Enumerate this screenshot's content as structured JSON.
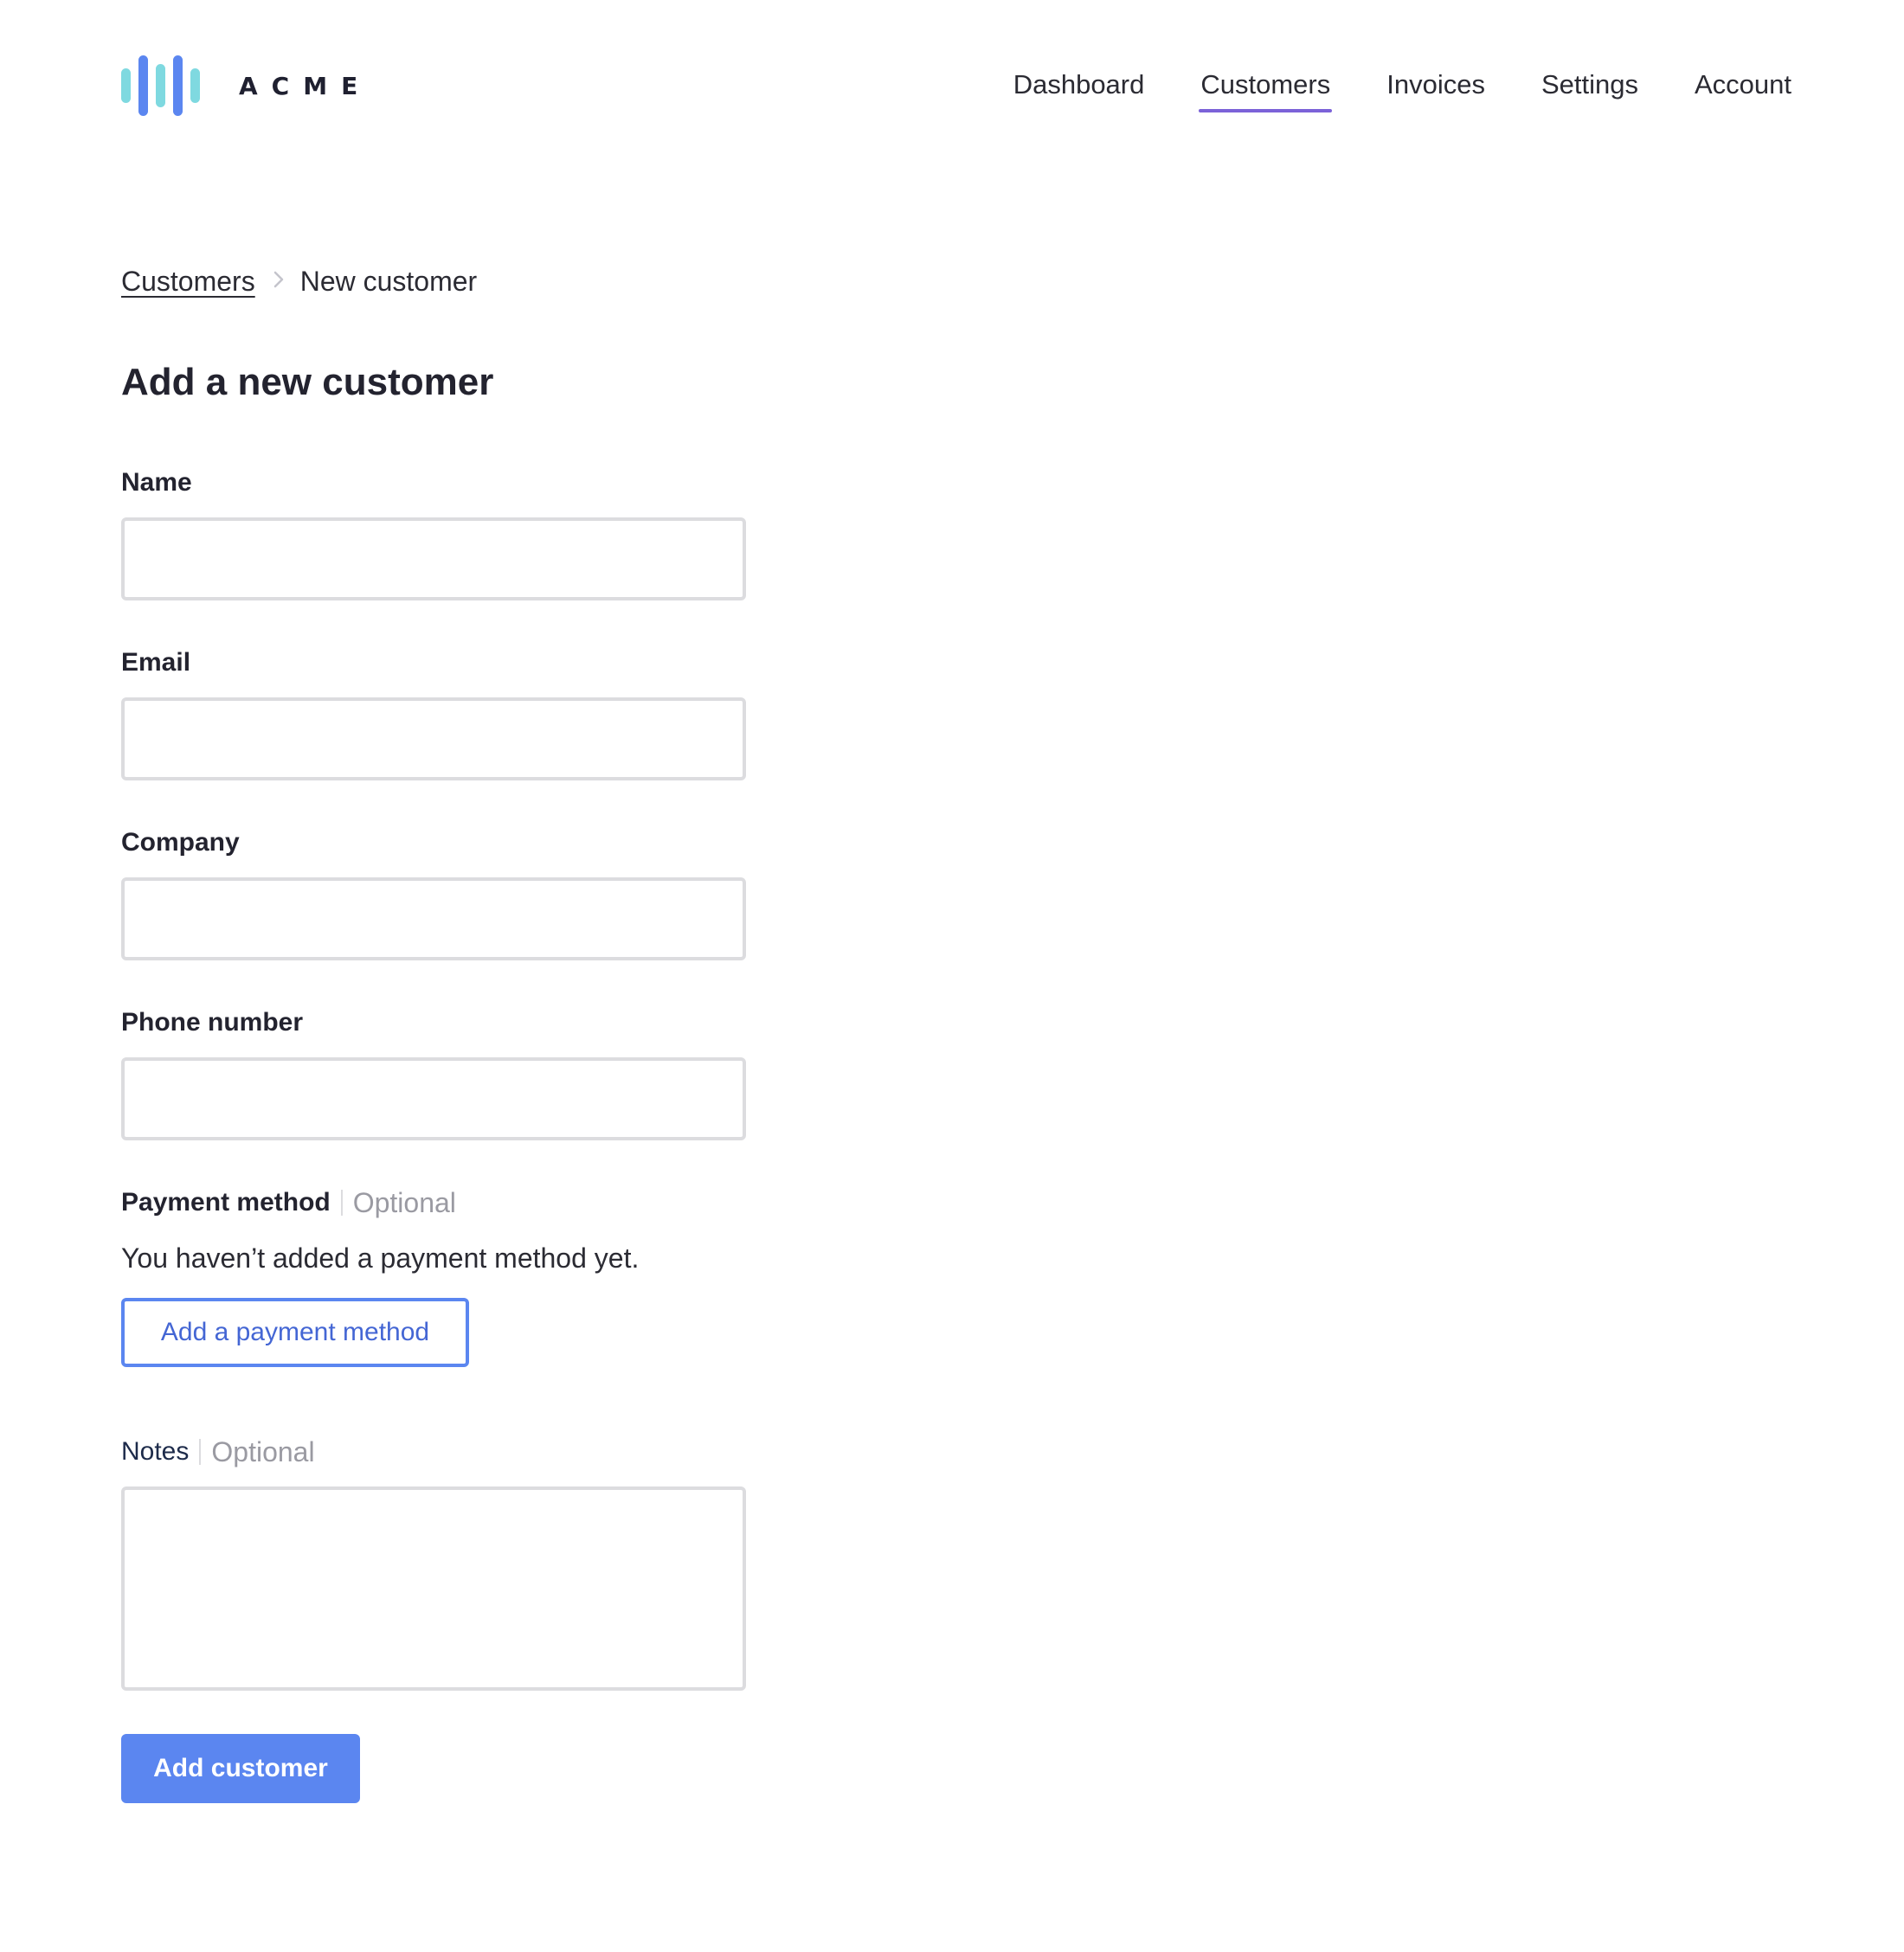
{
  "brand": {
    "wordmark": "ACME",
    "logo_icon": "audio-bars-logo",
    "logo_colors": [
      "#7fd9e0",
      "#5b86f0"
    ]
  },
  "nav": {
    "items": [
      {
        "label": "Dashboard",
        "active": false
      },
      {
        "label": "Customers",
        "active": true
      },
      {
        "label": "Invoices",
        "active": false
      },
      {
        "label": "Settings",
        "active": false
      },
      {
        "label": "Account",
        "active": false
      }
    ],
    "active_indicator_color": "#7b62d8"
  },
  "breadcrumb": {
    "parent": "Customers",
    "separator_icon": "chevron-right-icon",
    "current": "New customer"
  },
  "page": {
    "title": "Add a new customer"
  },
  "form": {
    "name": {
      "label": "Name",
      "value": "",
      "placeholder": ""
    },
    "email": {
      "label": "Email",
      "value": "",
      "placeholder": ""
    },
    "company": {
      "label": "Company",
      "value": "",
      "placeholder": ""
    },
    "phone": {
      "label": "Phone number",
      "value": "",
      "placeholder": ""
    },
    "payment": {
      "label": "Payment method",
      "optional": "Optional",
      "empty_message": "You haven’t added a payment method yet.",
      "add_button": "Add a payment method"
    },
    "notes": {
      "label": "Notes",
      "optional": "Optional",
      "value": "",
      "placeholder": ""
    },
    "submit_label": "Add customer"
  },
  "colors": {
    "accent": "#5b86f0",
    "accent_text": "#4466d4",
    "text": "#23232f",
    "muted": "#9a9aa2",
    "input_border": "#dcdcdf"
  }
}
